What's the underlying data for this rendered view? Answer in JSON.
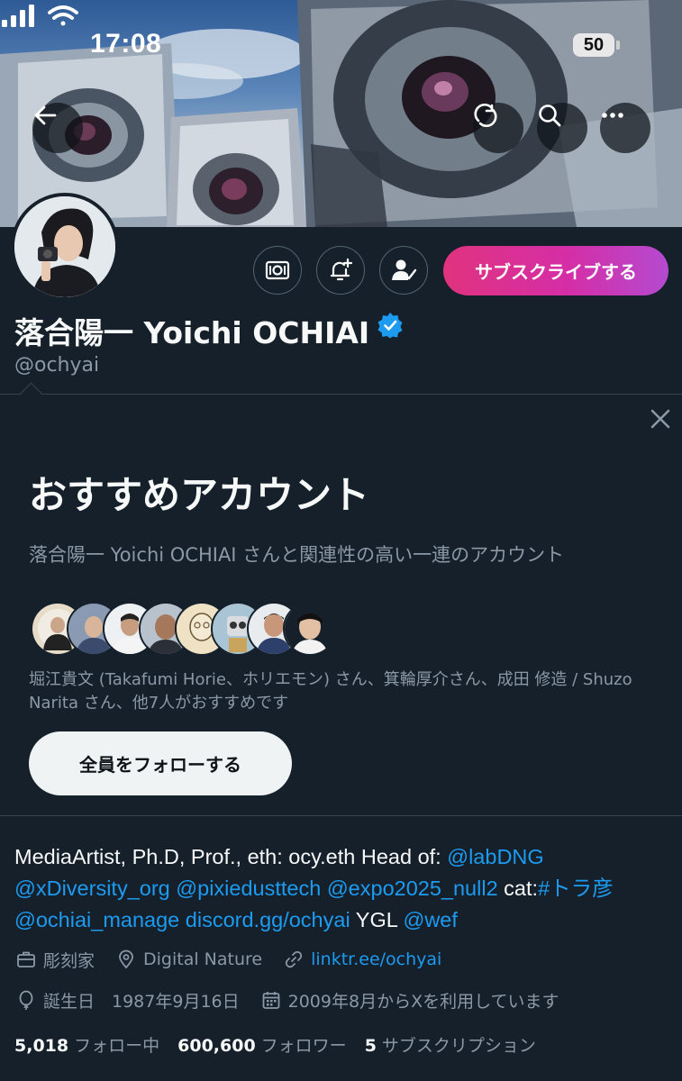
{
  "status_bar": {
    "time": "17:08",
    "battery": "50"
  },
  "header": {
    "back_icon": "arrow-left-icon",
    "actions": [
      "refresh-icon",
      "search-icon",
      "more-icon"
    ]
  },
  "profile": {
    "display_name": "落合陽一 Yoichi OCHIAI",
    "handle": "@ochyai",
    "verified": true,
    "subscribe_label": "サブスクライブする",
    "action_icons": [
      "subscription-icon",
      "notification-add-icon",
      "following-icon"
    ]
  },
  "recommendations": {
    "title": "おすすめアカウント",
    "subtitle": "落合陽一 Yoichi OCHIAI さんと関連性の高い一連のアカウント",
    "people_text": "堀江貴文 (Takafumi Horie、ホリエモン) さん、箕輪厚介さん、成田 修造 / Shuzo Narita さん、他7人がおすすめです",
    "follow_all_label": "全員をフォローする",
    "avatar_count": 8
  },
  "bio": {
    "line1_text": "MediaArtist, Ph.D, Prof., eth: ocy.eth Head of: ",
    "line1_link": "@labDNG",
    "line2_link1": "@xDiversity_org",
    "line2_link2": "@pixiedusttech",
    "line2_link3": "@expo2025_null2",
    "line2_text": " cat:",
    "line2_link4": "#トラ彦",
    "line3_link1": "@ochiai_manage",
    "line3_link2": "discord.gg/ochyai",
    "line3_text": " YGL ",
    "line3_link3": "@wef"
  },
  "meta": {
    "job": "彫刻家",
    "location": "Digital Nature",
    "website": "linktr.ee/ochyai",
    "birthday": "誕生日　1987年9月16日",
    "joined": "2009年8月からXを利用しています"
  },
  "stats": {
    "following_count": "5,018",
    "following_label": "フォロー中",
    "followers_count": "600,600",
    "followers_label": "フォロワー",
    "subscriptions_count": "5",
    "subscriptions_label": "サブスクリプション"
  },
  "colors": {
    "background": "#15202b",
    "link": "#1d9bf0",
    "muted": "#8b98a5",
    "subscribe_gradient_start": "#e0337f",
    "subscribe_gradient_end": "#b44ad0"
  }
}
